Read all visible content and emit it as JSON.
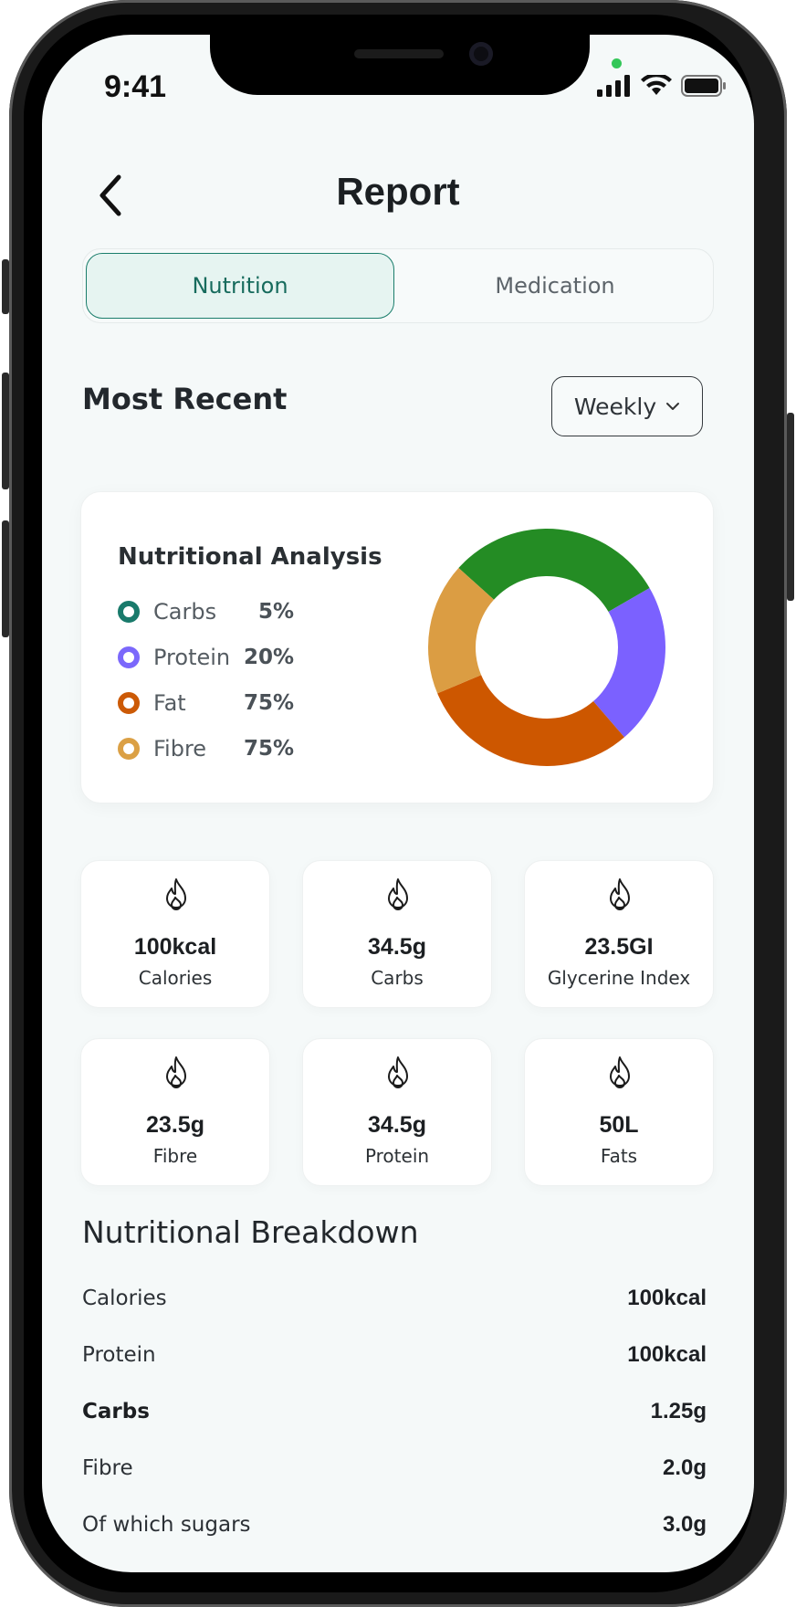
{
  "status": {
    "time": "9:41"
  },
  "header": {
    "title": "Report"
  },
  "tabs": [
    {
      "label": "Nutrition",
      "active": true
    },
    {
      "label": "Medication",
      "active": false
    }
  ],
  "most_recent": {
    "title": "Most Recent",
    "period": "Weekly"
  },
  "analysis": {
    "title": "Nutritional Analysis",
    "legend": [
      {
        "label": "Carbs",
        "value": "5%",
        "color": "#197a6b"
      },
      {
        "label": "Protein",
        "value": "20%",
        "color": "#7b68fb"
      },
      {
        "label": "Fat",
        "value": "75%",
        "color": "#cc5a06"
      },
      {
        "label": "Fibre",
        "value": "75%",
        "color": "#dba045"
      }
    ]
  },
  "chart_data": {
    "type": "pie",
    "categories": [
      "Green",
      "Purple",
      "Orange",
      "Amber"
    ],
    "values": [
      30,
      22,
      30,
      18
    ],
    "colors": [
      "#248c24",
      "#7b61ff",
      "#cd5700",
      "#db9d43"
    ],
    "donut": true
  },
  "stats": [
    {
      "value": "100kcal",
      "label": "Calories",
      "icon": "flame-icon"
    },
    {
      "value": "34.5g",
      "label": "Carbs",
      "icon": "flame-icon"
    },
    {
      "value": "23.5GI",
      "label": "Glycerine Index",
      "icon": "flame-icon"
    },
    {
      "value": "23.5g",
      "label": "Fibre",
      "icon": "flame-icon"
    },
    {
      "value": "34.5g",
      "label": "Protein",
      "icon": "flame-icon"
    },
    {
      "value": "50L",
      "label": "Fats",
      "icon": "flame-icon"
    }
  ],
  "breakdown": {
    "title": "Nutritional Breakdown",
    "rows": [
      {
        "label": "Calories",
        "value": "100kcal"
      },
      {
        "label": "Protein",
        "value": "100kcal"
      },
      {
        "label": "Carbs",
        "value": "1.25g",
        "bold": true
      },
      {
        "label": "Fibre",
        "value": "2.0g"
      },
      {
        "label": "Of which sugars",
        "value": "3.0g"
      }
    ]
  }
}
